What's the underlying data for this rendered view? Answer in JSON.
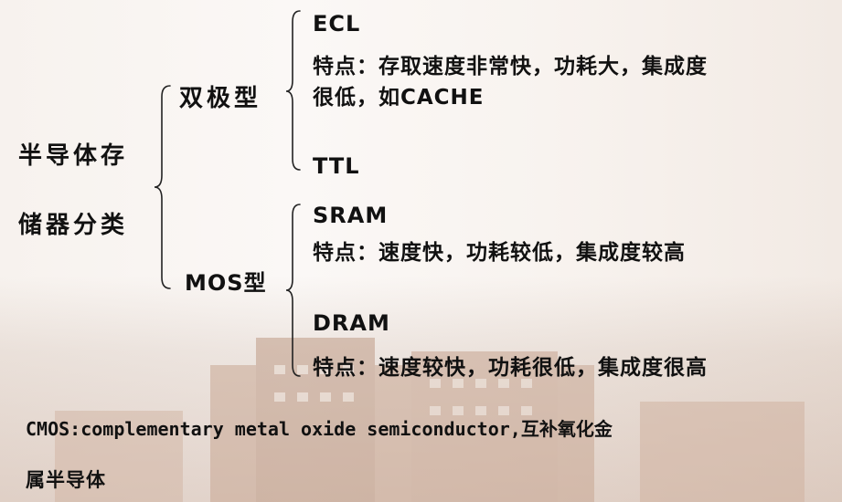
{
  "root": {
    "line1": "半导体存",
    "line2": "储器分类"
  },
  "bipolar": {
    "label": "双极型",
    "ecl": "ECL",
    "ecl_feature_1": "特点：存取速度非常快，功耗大，集成度",
    "ecl_feature_2": "很低，如CACHE",
    "ttl": "TTL"
  },
  "mos": {
    "label": "MOS型",
    "sram": "SRAM",
    "sram_feature": "特点：速度快，功耗较低，集成度较高",
    "dram": "DRAM",
    "dram_feature": "特点：速度较快，功耗很低，集成度很高"
  },
  "footnote": {
    "line1": "CMOS:complementary metal oxide semiconductor,互补氧化金",
    "line2": "属半导体"
  }
}
